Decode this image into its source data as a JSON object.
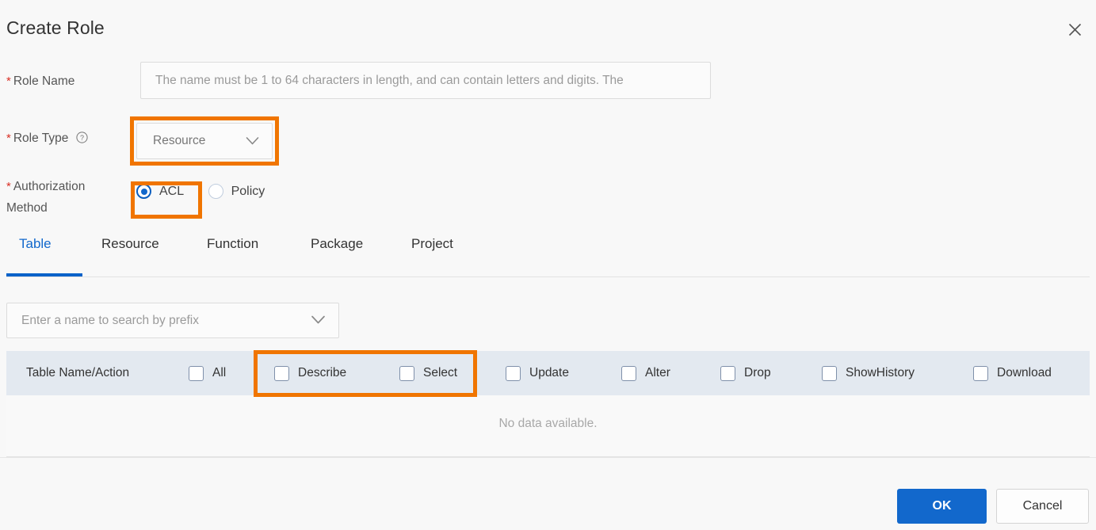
{
  "dialog": {
    "title": "Create Role",
    "close_icon": "close-icon"
  },
  "form": {
    "role_name": {
      "label": "Role Name",
      "required_marker": "*",
      "placeholder": "The name must be 1 to 64 characters in length, and can contain letters and digits. The",
      "value": ""
    },
    "role_type": {
      "label": "Role Type",
      "required_marker": "*",
      "help_icon": "question-circle-icon",
      "selected": "Resource",
      "chevron_icon": "chevron-down-icon"
    },
    "authorization_method": {
      "label_line1": "Authorization",
      "label_line2": "Method",
      "required_marker": "*",
      "options": [
        {
          "label": "ACL",
          "checked": true
        },
        {
          "label": "Policy",
          "checked": false
        }
      ]
    }
  },
  "tabs": [
    {
      "label": "Table",
      "active": true
    },
    {
      "label": "Resource",
      "active": false
    },
    {
      "label": "Function",
      "active": false
    },
    {
      "label": "Package",
      "active": false
    },
    {
      "label": "Project",
      "active": false
    }
  ],
  "search": {
    "placeholder": "Enter a name to search by prefix",
    "value": "",
    "chevron_icon": "chevron-down-icon"
  },
  "table": {
    "name_column_header": "Table Name/Action",
    "permission_columns": [
      {
        "label": "All",
        "checked": false
      },
      {
        "label": "Describe",
        "checked": false
      },
      {
        "label": "Select",
        "checked": false
      },
      {
        "label": "Update",
        "checked": false
      },
      {
        "label": "Alter",
        "checked": false
      },
      {
        "label": "Drop",
        "checked": false
      },
      {
        "label": "ShowHistory",
        "checked": false
      },
      {
        "label": "Download",
        "checked": false
      }
    ],
    "empty_message": "No data available."
  },
  "footer": {
    "ok_label": "OK",
    "cancel_label": "Cancel"
  },
  "annotations": {
    "color": "#f07500",
    "boxes": [
      {
        "name": "role-type-highlight"
      },
      {
        "name": "acl-option-highlight"
      },
      {
        "name": "describe-select-highlight"
      }
    ]
  },
  "colors": {
    "accent_blue": "#1268cc",
    "required_red": "#d93026",
    "annotation_orange": "#f07500",
    "table_header_bg": "#e3e9f0",
    "page_bg": "#f8f8f8"
  }
}
